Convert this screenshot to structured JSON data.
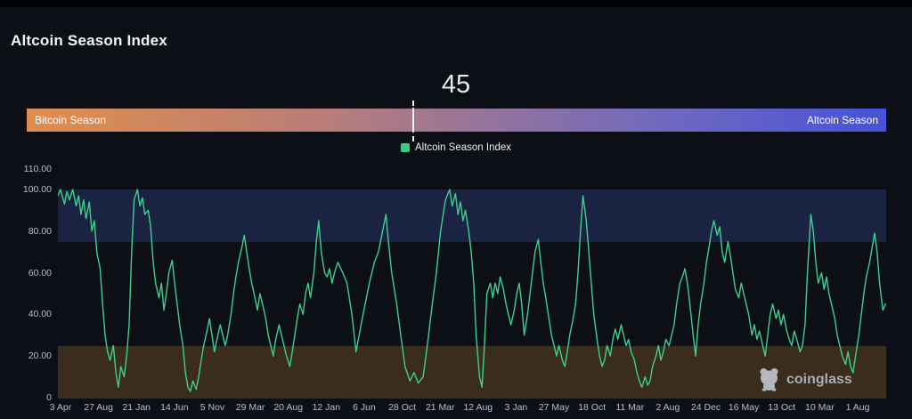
{
  "header": {
    "title": "Altcoin Season Index"
  },
  "gauge": {
    "value": "45",
    "left_label": "Bitcoin Season",
    "right_label": "Altcoin Season",
    "marker_percent": 45,
    "gradient": [
      "#e08e4e",
      "#b87d79",
      "#92739f",
      "#6f68c0",
      "#4652d8"
    ],
    "gradient_stops": [
      0,
      35,
      55,
      75,
      100
    ]
  },
  "legend": {
    "label": "Altcoin Season Index",
    "swatch_color": "#3fc981"
  },
  "watermark": {
    "text": "coinglass",
    "icon_color": "#c2c6cc"
  },
  "chart_data": {
    "type": "line",
    "title": "Altcoin Season Index",
    "series_name": "Altcoin Season Index",
    "line_color": "#3ecf8e",
    "ylim": [
      0,
      110
    ],
    "grid": false,
    "y_ticks": [
      "110.00",
      "100.00",
      "80.00",
      "60.00",
      "40.00",
      "20.00",
      "0"
    ],
    "y_tick_values": [
      110,
      100,
      80,
      60,
      40,
      20,
      0
    ],
    "x_ticks": [
      "3 Apr",
      "27 Aug",
      "21 Jan",
      "14 Jun",
      "5 Nov",
      "29 Mar",
      "20 Aug",
      "12 Jan",
      "6 Jun",
      "28 Oct",
      "21 Mar",
      "12 Aug",
      "3 Jan",
      "27 May",
      "18 Oct",
      "11 Mar",
      "2 Aug",
      "24 Dec",
      "16 May",
      "13 Oct",
      "10 Mar",
      "1 Aug"
    ],
    "bands": [
      {
        "name": "altcoin-season-zone",
        "from": 75,
        "to": 100,
        "color": "#1b2342"
      },
      {
        "name": "bitcoin-season-zone",
        "from": 0,
        "to": 25,
        "color": "#3b2d1e"
      }
    ],
    "current_value": 45,
    "points_format": "[percent_along_time_axis, index_value]",
    "points": [
      [
        0,
        97
      ],
      [
        0.3,
        100
      ],
      [
        0.8,
        93
      ],
      [
        1.1,
        99
      ],
      [
        1.4,
        95
      ],
      [
        1.8,
        100
      ],
      [
        2.2,
        92
      ],
      [
        2.5,
        97
      ],
      [
        2.8,
        88
      ],
      [
        3.1,
        95
      ],
      [
        3.4,
        86
      ],
      [
        3.8,
        94
      ],
      [
        4.1,
        80
      ],
      [
        4.4,
        85
      ],
      [
        4.7,
        70
      ],
      [
        5.1,
        62
      ],
      [
        5.4,
        45
      ],
      [
        5.7,
        30
      ],
      [
        6,
        22
      ],
      [
        6.3,
        18
      ],
      [
        6.7,
        25
      ],
      [
        7,
        12
      ],
      [
        7.3,
        5
      ],
      [
        7.6,
        15
      ],
      [
        8,
        10
      ],
      [
        8.3,
        20
      ],
      [
        8.6,
        35
      ],
      [
        8.9,
        70
      ],
      [
        9.2,
        95
      ],
      [
        9.6,
        100
      ],
      [
        9.9,
        92
      ],
      [
        10.2,
        96
      ],
      [
        10.5,
        88
      ],
      [
        10.9,
        90
      ],
      [
        11.2,
        82
      ],
      [
        11.5,
        65
      ],
      [
        11.8,
        55
      ],
      [
        12.2,
        48
      ],
      [
        12.5,
        55
      ],
      [
        12.8,
        42
      ],
      [
        13.1,
        50
      ],
      [
        13.4,
        60
      ],
      [
        13.8,
        66
      ],
      [
        14.1,
        55
      ],
      [
        14.4,
        45
      ],
      [
        14.7,
        35
      ],
      [
        15.1,
        25
      ],
      [
        15.4,
        12
      ],
      [
        15.7,
        5
      ],
      [
        16,
        3
      ],
      [
        16.3,
        8
      ],
      [
        16.7,
        4
      ],
      [
        17,
        10
      ],
      [
        17.3,
        18
      ],
      [
        17.6,
        25
      ],
      [
        18,
        32
      ],
      [
        18.3,
        38
      ],
      [
        18.6,
        30
      ],
      [
        18.9,
        22
      ],
      [
        19.2,
        28
      ],
      [
        19.6,
        35
      ],
      [
        19.9,
        30
      ],
      [
        20.2,
        25
      ],
      [
        20.5,
        30
      ],
      [
        20.9,
        40
      ],
      [
        21.2,
        50
      ],
      [
        21.5,
        58
      ],
      [
        21.8,
        65
      ],
      [
        22.2,
        72
      ],
      [
        22.5,
        78
      ],
      [
        22.8,
        70
      ],
      [
        23.1,
        62
      ],
      [
        23.4,
        55
      ],
      [
        23.8,
        48
      ],
      [
        24.1,
        42
      ],
      [
        24.4,
        50
      ],
      [
        24.7,
        45
      ],
      [
        25.1,
        38
      ],
      [
        25.4,
        30
      ],
      [
        25.7,
        25
      ],
      [
        26,
        20
      ],
      [
        26.3,
        28
      ],
      [
        26.7,
        35
      ],
      [
        27,
        30
      ],
      [
        27.3,
        25
      ],
      [
        27.6,
        20
      ],
      [
        28,
        15
      ],
      [
        28.3,
        22
      ],
      [
        28.6,
        30
      ],
      [
        28.9,
        38
      ],
      [
        29.2,
        45
      ],
      [
        29.6,
        40
      ],
      [
        29.9,
        50
      ],
      [
        30.2,
        55
      ],
      [
        30.5,
        48
      ],
      [
        30.9,
        60
      ],
      [
        31.2,
        75
      ],
      [
        31.5,
        85
      ],
      [
        31.8,
        70
      ],
      [
        32.2,
        60
      ],
      [
        32.5,
        58
      ],
      [
        32.8,
        62
      ],
      [
        33.1,
        55
      ],
      [
        33.4,
        60
      ],
      [
        33.8,
        65
      ],
      [
        34.4,
        60
      ],
      [
        34.9,
        55
      ],
      [
        35.5,
        40
      ],
      [
        36,
        22
      ],
      [
        36.6,
        35
      ],
      [
        37.1,
        45
      ],
      [
        37.6,
        55
      ],
      [
        38.2,
        65
      ],
      [
        38.7,
        70
      ],
      [
        39.2,
        80
      ],
      [
        39.6,
        88
      ],
      [
        39.9,
        75
      ],
      [
        40.3,
        60
      ],
      [
        40.9,
        45
      ],
      [
        41.4,
        30
      ],
      [
        41.9,
        15
      ],
      [
        42.5,
        8
      ],
      [
        43,
        12
      ],
      [
        43.5,
        7
      ],
      [
        44.1,
        10
      ],
      [
        44.6,
        25
      ],
      [
        45.2,
        45
      ],
      [
        45.7,
        60
      ],
      [
        46.2,
        80
      ],
      [
        46.8,
        95
      ],
      [
        47.3,
        100
      ],
      [
        47.6,
        92
      ],
      [
        48,
        98
      ],
      [
        48.3,
        88
      ],
      [
        48.6,
        94
      ],
      [
        48.9,
        85
      ],
      [
        49.2,
        90
      ],
      [
        49.6,
        80
      ],
      [
        49.9,
        70
      ],
      [
        50.2,
        55
      ],
      [
        50.5,
        30
      ],
      [
        50.9,
        10
      ],
      [
        51.2,
        5
      ],
      [
        51.5,
        25
      ],
      [
        51.8,
        50
      ],
      [
        52.2,
        55
      ],
      [
        52.5,
        48
      ],
      [
        52.8,
        55
      ],
      [
        53.1,
        50
      ],
      [
        53.4,
        58
      ],
      [
        53.8,
        52
      ],
      [
        54.1,
        45
      ],
      [
        54.4,
        40
      ],
      [
        54.7,
        35
      ],
      [
        55.1,
        42
      ],
      [
        55.4,
        50
      ],
      [
        55.7,
        55
      ],
      [
        56,
        45
      ],
      [
        56.3,
        30
      ],
      [
        56.7,
        40
      ],
      [
        57,
        50
      ],
      [
        57.3,
        60
      ],
      [
        57.6,
        70
      ],
      [
        58,
        76
      ],
      [
        58.3,
        65
      ],
      [
        58.6,
        55
      ],
      [
        58.9,
        48
      ],
      [
        59.2,
        40
      ],
      [
        59.6,
        30
      ],
      [
        59.9,
        25
      ],
      [
        60.2,
        20
      ],
      [
        60.5,
        25
      ],
      [
        60.9,
        18
      ],
      [
        61.2,
        15
      ],
      [
        61.5,
        22
      ],
      [
        61.8,
        30
      ],
      [
        62.2,
        38
      ],
      [
        62.5,
        45
      ],
      [
        62.8,
        60
      ],
      [
        63.1,
        80
      ],
      [
        63.4,
        97
      ],
      [
        63.8,
        85
      ],
      [
        64.1,
        70
      ],
      [
        64.4,
        55
      ],
      [
        64.7,
        40
      ],
      [
        65.1,
        28
      ],
      [
        65.4,
        20
      ],
      [
        65.7,
        15
      ],
      [
        66,
        18
      ],
      [
        66.3,
        25
      ],
      [
        66.7,
        20
      ],
      [
        67,
        28
      ],
      [
        67.3,
        33
      ],
      [
        67.6,
        28
      ],
      [
        68,
        35
      ],
      [
        68.3,
        30
      ],
      [
        68.6,
        25
      ],
      [
        68.9,
        28
      ],
      [
        69.2,
        22
      ],
      [
        69.6,
        18
      ],
      [
        69.9,
        12
      ],
      [
        70.2,
        8
      ],
      [
        70.5,
        5
      ],
      [
        70.9,
        10
      ],
      [
        71.2,
        6
      ],
      [
        71.5,
        8
      ],
      [
        71.8,
        15
      ],
      [
        72.2,
        20
      ],
      [
        72.5,
        25
      ],
      [
        72.8,
        18
      ],
      [
        73.1,
        22
      ],
      [
        73.4,
        28
      ],
      [
        73.8,
        25
      ],
      [
        74.1,
        30
      ],
      [
        74.4,
        35
      ],
      [
        74.7,
        45
      ],
      [
        75.1,
        55
      ],
      [
        75.4,
        58
      ],
      [
        75.7,
        62
      ],
      [
        76,
        55
      ],
      [
        76.3,
        45
      ],
      [
        76.7,
        30
      ],
      [
        77,
        20
      ],
      [
        77.3,
        35
      ],
      [
        77.6,
        45
      ],
      [
        78,
        55
      ],
      [
        78.3,
        65
      ],
      [
        78.6,
        72
      ],
      [
        78.9,
        80
      ],
      [
        79.2,
        85
      ],
      [
        79.6,
        78
      ],
      [
        79.9,
        82
      ],
      [
        80.2,
        70
      ],
      [
        80.5,
        65
      ],
      [
        80.9,
        75
      ],
      [
        81.2,
        68
      ],
      [
        81.5,
        60
      ],
      [
        81.8,
        52
      ],
      [
        82.2,
        48
      ],
      [
        82.5,
        55
      ],
      [
        82.8,
        50
      ],
      [
        83.1,
        45
      ],
      [
        83.4,
        40
      ],
      [
        83.8,
        30
      ],
      [
        84.1,
        35
      ],
      [
        84.4,
        28
      ],
      [
        84.7,
        32
      ],
      [
        85.1,
        25
      ],
      [
        85.4,
        20
      ],
      [
        85.7,
        30
      ],
      [
        86,
        40
      ],
      [
        86.3,
        45
      ],
      [
        86.7,
        38
      ],
      [
        87,
        42
      ],
      [
        87.3,
        35
      ],
      [
        87.6,
        40
      ],
      [
        88,
        32
      ],
      [
        88.3,
        28
      ],
      [
        88.6,
        25
      ],
      [
        88.9,
        32
      ],
      [
        89.2,
        28
      ],
      [
        89.6,
        22
      ],
      [
        89.9,
        25
      ],
      [
        90.2,
        35
      ],
      [
        90.5,
        60
      ],
      [
        90.9,
        88
      ],
      [
        91.2,
        80
      ],
      [
        91.5,
        65
      ],
      [
        91.8,
        55
      ],
      [
        92.2,
        60
      ],
      [
        92.5,
        52
      ],
      [
        92.8,
        58
      ],
      [
        93.1,
        50
      ],
      [
        93.4,
        45
      ],
      [
        93.8,
        38
      ],
      [
        94.1,
        30
      ],
      [
        94.4,
        25
      ],
      [
        94.7,
        20
      ],
      [
        95.1,
        16
      ],
      [
        95.4,
        22
      ],
      [
        95.7,
        15
      ],
      [
        96,
        12
      ],
      [
        96.3,
        20
      ],
      [
        96.7,
        30
      ],
      [
        97,
        40
      ],
      [
        97.3,
        50
      ],
      [
        97.6,
        58
      ],
      [
        98,
        65
      ],
      [
        98.3,
        72
      ],
      [
        98.6,
        79
      ],
      [
        98.9,
        70
      ],
      [
        99.2,
        55
      ],
      [
        99.6,
        42
      ],
      [
        99.9,
        45
      ]
    ]
  }
}
